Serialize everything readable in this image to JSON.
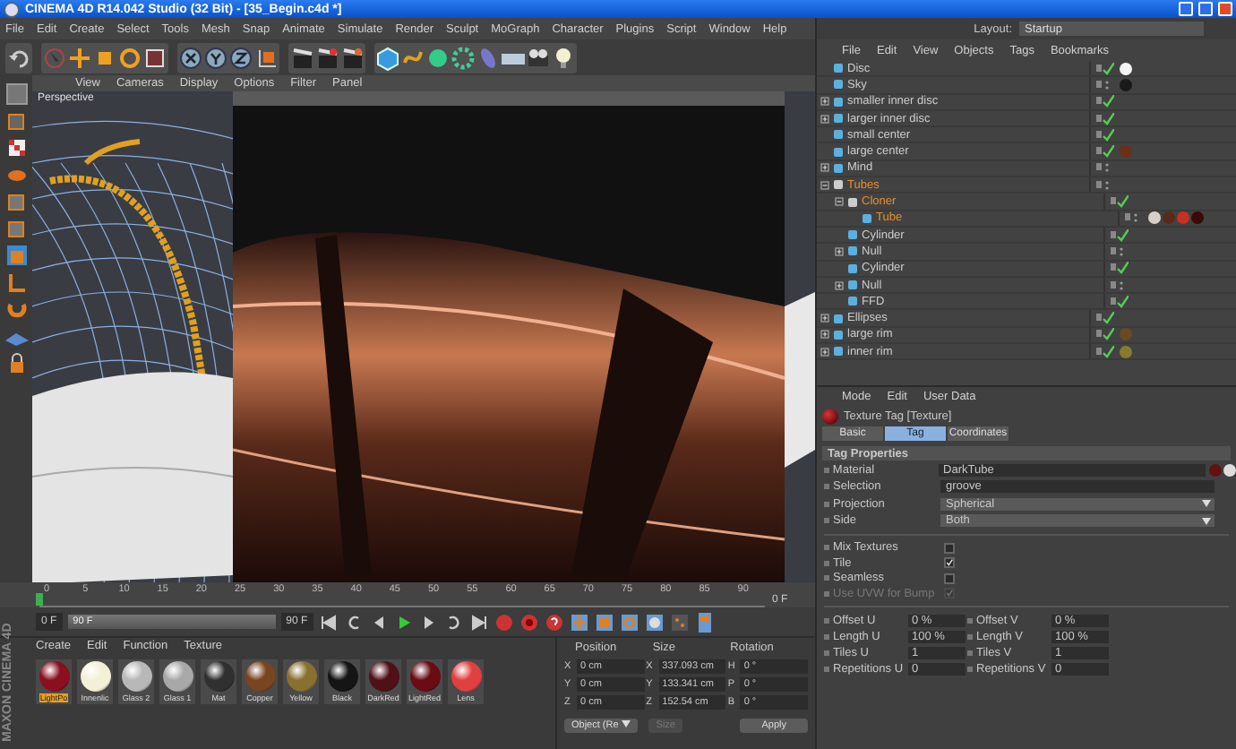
{
  "window": {
    "title": "CINEMA 4D R14.042 Studio (32 Bit) - [35_Begin.c4d *]"
  },
  "menu": [
    "File",
    "Edit",
    "Create",
    "Select",
    "Tools",
    "Mesh",
    "Snap",
    "Animate",
    "Simulate",
    "Render",
    "Sculpt",
    "MoGraph",
    "Character",
    "Plugins",
    "Script",
    "Window",
    "Help"
  ],
  "layout": {
    "label": "Layout:",
    "value": "Startup"
  },
  "viewport": {
    "menu": [
      "View",
      "Cameras",
      "Display",
      "Options",
      "Filter",
      "Panel"
    ],
    "camera": "Perspective"
  },
  "object_manager": {
    "menu": [
      "File",
      "Edit",
      "View",
      "Objects",
      "Tags",
      "Bookmarks"
    ],
    "items": [
      {
        "name": "Disc",
        "selected": false,
        "enabled": true,
        "tags": [
          {
            "color": "#f4f4f4"
          }
        ]
      },
      {
        "name": "Sky",
        "selected": false,
        "enabled": false,
        "tags": [
          {
            "color": "#1a1a1a"
          }
        ]
      },
      {
        "name": "smaller inner disc",
        "selected": false,
        "enabled": true,
        "expanded": false
      },
      {
        "name": "larger inner disc",
        "selected": false,
        "enabled": true,
        "expanded": false
      },
      {
        "name": "small center",
        "selected": false,
        "enabled": true
      },
      {
        "name": "large center",
        "selected": false,
        "enabled": true,
        "tags": [
          {
            "color": "#6a3018"
          }
        ]
      },
      {
        "name": "Mind",
        "selected": false,
        "enabled": false,
        "expanded": false
      },
      {
        "name": "Tubes",
        "selected": true,
        "enabled": false,
        "expanded": true,
        "children": [
          {
            "name": "Cloner",
            "selected": true,
            "enabled": true,
            "expanded": true,
            "children": [
              {
                "name": "Tube",
                "selected": true,
                "enabled": false,
                "tags": [
                  {
                    "color": "#d8d0c8"
                  },
                  {
                    "color": "#5a2a18"
                  },
                  {
                    "color": "#c83020"
                  },
                  {
                    "color": "#3a0a08"
                  }
                ]
              }
            ]
          },
          {
            "name": "Cylinder",
            "selected": false,
            "enabled": true
          },
          {
            "name": "Null",
            "selected": false,
            "enabled": false,
            "expanded": false
          },
          {
            "name": "Cylinder",
            "selected": false,
            "enabled": true
          },
          {
            "name": "Null",
            "selected": false,
            "enabled": false,
            "expanded": false
          },
          {
            "name": "FFD",
            "selected": false,
            "enabled": true
          }
        ]
      },
      {
        "name": "Ellipses",
        "selected": false,
        "enabled": true,
        "expanded": false
      },
      {
        "name": "large rim",
        "selected": false,
        "enabled": true,
        "expanded": false,
        "tags": [
          {
            "color": "#6a4a20"
          }
        ]
      },
      {
        "name": "inner rim",
        "selected": false,
        "enabled": true,
        "expanded": false,
        "tags": [
          {
            "color": "#8a7a30"
          }
        ]
      }
    ]
  },
  "attributes": {
    "menu": [
      "Mode",
      "Edit",
      "User Data"
    ],
    "title": "Texture Tag [Texture]",
    "tabs": [
      {
        "label": "Basic",
        "selected": false
      },
      {
        "label": "Tag",
        "selected": true
      },
      {
        "label": "Coordinates",
        "selected": false
      }
    ],
    "section": "Tag Properties",
    "fields": [
      {
        "label": "Material",
        "value": "DarkTube",
        "kind": "link"
      },
      {
        "label": "Selection",
        "value": "groove",
        "kind": "text"
      },
      {
        "label": "Projection",
        "value": "Spherical",
        "kind": "dropdown"
      },
      {
        "label": "Side",
        "value": "Both",
        "kind": "dropdown"
      }
    ],
    "checks": [
      {
        "label": "Mix Textures",
        "checked": false,
        "disabled": false
      },
      {
        "label": "Tile",
        "checked": true,
        "disabled": false
      },
      {
        "label": "Seamless",
        "checked": false,
        "disabled": false
      },
      {
        "label": "Use UVW for Bump",
        "checked": true,
        "disabled": true
      }
    ],
    "pairs": [
      {
        "label": "Offset U",
        "value": "0 %"
      },
      {
        "label": "Offset V",
        "value": "0 %"
      },
      {
        "label": "Length U",
        "value": "100 %"
      },
      {
        "label": "Length V",
        "value": "100 %"
      },
      {
        "label": "Tiles U",
        "value": "1"
      },
      {
        "label": "Tiles V",
        "value": "1"
      },
      {
        "label": "Repetitions U",
        "value": "0"
      },
      {
        "label": "Repetitions V",
        "value": "0"
      }
    ]
  },
  "timeline": {
    "ticks": [
      "0",
      "5",
      "10",
      "15",
      "20",
      "25",
      "30",
      "35",
      "40",
      "45",
      "50",
      "55",
      "60",
      "65",
      "70",
      "75",
      "80",
      "85",
      "90"
    ],
    "current": "0 F",
    "start": "0 F",
    "range": {
      "label": "90 F",
      "level": 1
    },
    "end": "90 F"
  },
  "materials": {
    "menu": [
      "Create",
      "Edit",
      "Function",
      "Texture"
    ],
    "items": [
      {
        "name": "LightPo",
        "selected": true,
        "color": "#8a1020"
      },
      {
        "name": "Innenlic",
        "selected": false,
        "color": "#f4f0d8"
      },
      {
        "name": "Glass 2",
        "selected": false,
        "color": "#b8b8b8"
      },
      {
        "name": "Glass 1",
        "selected": false,
        "color": "#a8a8a8"
      },
      {
        "name": "Mat",
        "selected": false,
        "color": "#303030"
      },
      {
        "name": "Copper",
        "selected": false,
        "color": "#7a4420"
      },
      {
        "name": "Yellow",
        "selected": false,
        "color": "#8a7030"
      },
      {
        "name": "Black",
        "selected": false,
        "color": "#151515"
      },
      {
        "name": "DarkRed",
        "selected": false,
        "color": "#501018"
      },
      {
        "name": "LightRed",
        "selected": false,
        "color": "#6a0c14"
      },
      {
        "name": "Lens",
        "selected": false,
        "color": "#e04040"
      }
    ]
  },
  "coordinates": {
    "headers": [
      "Position",
      "Size",
      "Rotation"
    ],
    "rows": [
      {
        "axis": "X",
        "position": "0 cm",
        "size_axis": "X",
        "size": "337.093 cm",
        "rot_axis": "H",
        "rotation": "0 °"
      },
      {
        "axis": "Y",
        "position": "0 cm",
        "size_axis": "Y",
        "size": "133.341 cm",
        "rot_axis": "P",
        "rotation": "0 °"
      },
      {
        "axis": "Z",
        "position": "0 cm",
        "size_axis": "Z",
        "size": "152.54 cm",
        "rot_axis": "B",
        "rotation": "0 °"
      }
    ],
    "mode": "Object (Re",
    "size_mode": "Size",
    "apply": "Apply"
  },
  "logo": "MAXON CINEMA 4D"
}
